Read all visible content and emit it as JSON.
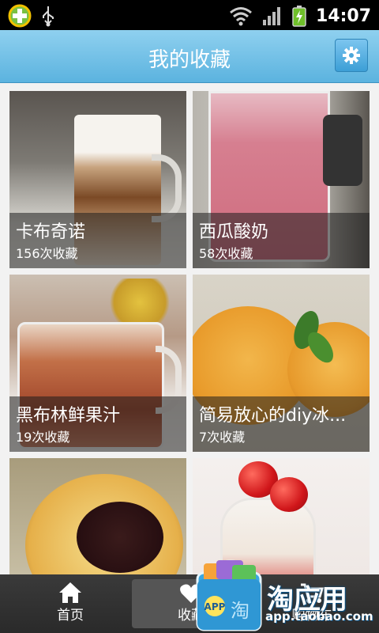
{
  "status_bar": {
    "time": "14:07",
    "icons": [
      "add-circle-icon",
      "usb-icon",
      "wifi-icon",
      "signal-icon",
      "battery-icon"
    ]
  },
  "header": {
    "title": "我的收藏",
    "settings_icon": "gear-icon"
  },
  "favorites": [
    {
      "name": "卡布奇诺",
      "count": "156次收藏"
    },
    {
      "name": "西瓜酸奶",
      "count": "58次收藏"
    },
    {
      "name": "黑布林鲜果汁",
      "count": "19次收藏"
    },
    {
      "name": "简易放心的diy冰...",
      "count": "7次收藏"
    },
    {
      "name": "",
      "count": ""
    },
    {
      "name": "",
      "count": ""
    }
  ],
  "tabs": [
    {
      "label": "首页",
      "icon": "home-icon"
    },
    {
      "label": "收藏",
      "icon": "heart-icon"
    },
    {
      "label": "购物车",
      "icon": "cart-icon"
    }
  ],
  "ad": {
    "title": "淘应用",
    "url": "app.taobao.com",
    "badge": "APP"
  },
  "colors": {
    "header": "#5bb3df",
    "tabbar": "#2f2f2f",
    "overlay": "rgba(30,30,30,0.55)"
  }
}
